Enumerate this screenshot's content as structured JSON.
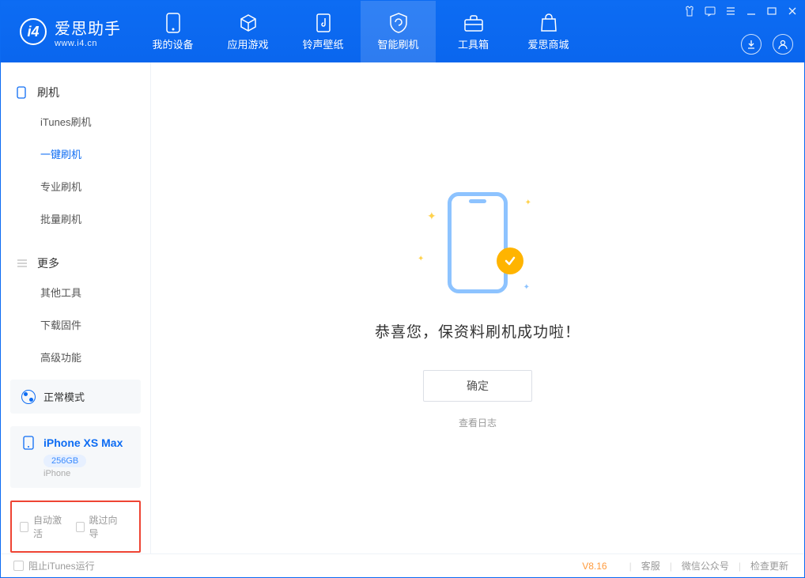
{
  "app": {
    "name": "爱思助手",
    "url": "www.i4.cn"
  },
  "tabs": [
    {
      "label": "我的设备"
    },
    {
      "label": "应用游戏"
    },
    {
      "label": "铃声壁纸"
    },
    {
      "label": "智能刷机"
    },
    {
      "label": "工具箱"
    },
    {
      "label": "爱思商城"
    }
  ],
  "sidebar": {
    "group1_title": "刷机",
    "group1_items": [
      "iTunes刷机",
      "一键刷机",
      "专业刷机",
      "批量刷机"
    ],
    "group2_title": "更多",
    "group2_items": [
      "其他工具",
      "下载固件",
      "高级功能"
    ]
  },
  "mode": {
    "label": "正常模式"
  },
  "device": {
    "name": "iPhone XS Max",
    "storage": "256GB",
    "type": "iPhone"
  },
  "checkboxes": {
    "auto_activate": "自动激活",
    "skip_guide": "跳过向导"
  },
  "main": {
    "title": "恭喜您，保资料刷机成功啦！",
    "ok_btn": "确定",
    "log_link": "查看日志"
  },
  "footer": {
    "block_itunes": "阻止iTunes运行",
    "version": "V8.16",
    "links": [
      "客服",
      "微信公众号",
      "检查更新"
    ]
  }
}
